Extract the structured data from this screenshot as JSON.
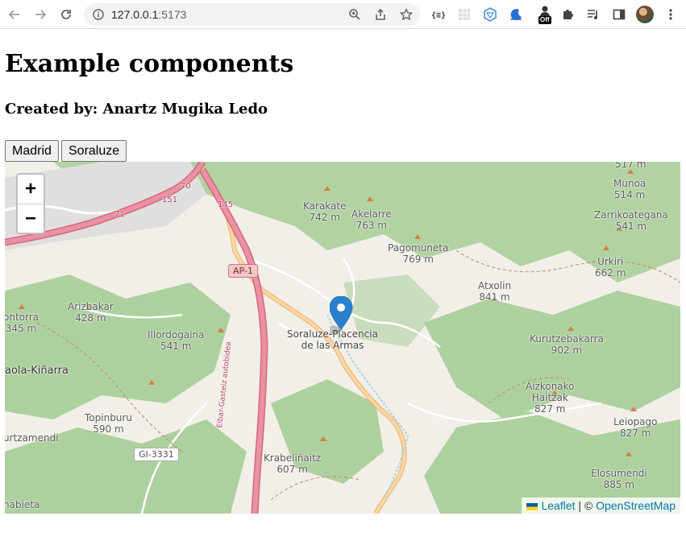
{
  "browser": {
    "url_host": "127.0.0.1",
    "url_port": ":5173",
    "extension_badge": "Off"
  },
  "page": {
    "title": "Example components",
    "author": "Created by: Anartz Mugika Ledo"
  },
  "buttons": {
    "madrid": "Madrid",
    "soraluze": "Soraluze"
  },
  "map": {
    "zoom_in": "+",
    "zoom_out": "−",
    "attribution": {
      "leaflet": "Leaflet",
      "separator": " | © ",
      "osm": "OpenStreetMap"
    },
    "labels": {
      "soraluze_1": "Soraluze-Placencia",
      "soraluze_2": "de las Armas",
      "karakate": "Karakate",
      "karakate_h": "742 m",
      "akelarre": "Akelarre",
      "akelarre_h": "763 m",
      "pagomuneta": "Pagomuneta",
      "pagomuneta_h": "769 m",
      "munoa": "Munoa",
      "munoa_h": "514 m",
      "zarrikoategana": "Zarrikoategana",
      "zarrikoategana_h": "541 m",
      "urkiri": "Urkiri",
      "urkiri_h": "662 m",
      "atxolin": "Atxolin",
      "atxolin_h": "841 m",
      "arizbakar": "Arizbakar",
      "arizbakar_h": "428 m",
      "illordogaina": "Illordogaina",
      "illordogaina_h": "541 m",
      "kurutzebakarra": "Kurutzebakarra",
      "kurutzebakarra_h": "902 m",
      "aizkonako": "Aizkonako",
      "haitzak": "Haitzak",
      "haitzak_h": "827 m",
      "topinburu": "Topinburu",
      "topinburu_h": "590 m",
      "leiopago": "Leiopago",
      "leiopago_h": "827 m",
      "krabelinaitz": "Krabeliñaitz",
      "krabelinaitz_h": "607 m",
      "elosumendi": "Elosumendi",
      "elosumendi_h": "885 m",
      "ontorra": "ontorra",
      "ontorra_h": "345 m",
      "aola": "aola-Kiñarra",
      "urtzamendi": "urtzamendi",
      "nabieta": "nabieta",
      "munoa_top": "517 m",
      "shield_ap1": "AP-1",
      "shield_gi": "GI-3331",
      "road_145": "145",
      "road_151": "151",
      "road_70": "70",
      "road_71": "71",
      "autobidea": "Eibar-Gasteiz autobidea"
    }
  },
  "colors": {
    "forest": "#add19e",
    "land": "#f2efe9",
    "motorway": "#e892a2",
    "primary": "#fcd6a4",
    "marker": "#2a81cb",
    "link": "#0078a8"
  }
}
